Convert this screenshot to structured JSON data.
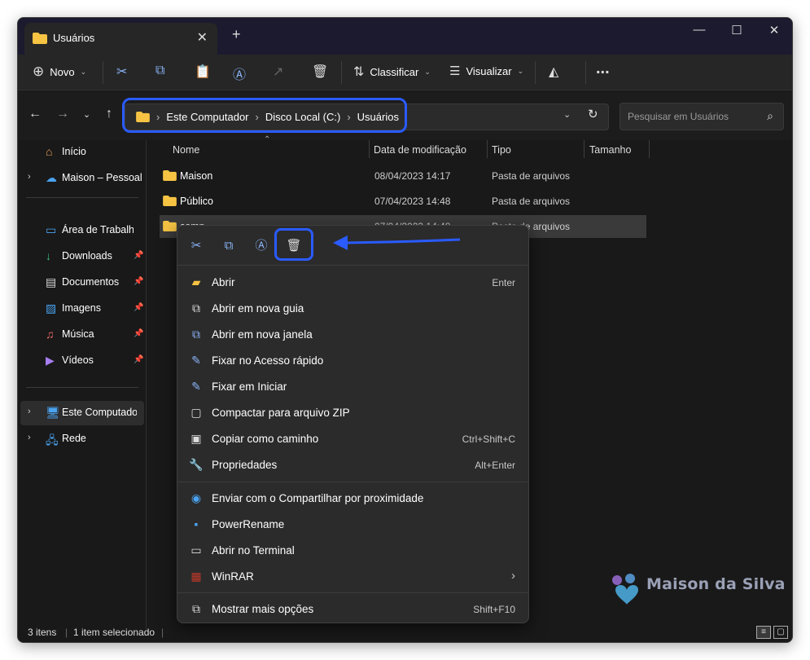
{
  "window": {
    "tab_title": "Usuários",
    "new_tab_icon": "plus-icon",
    "controls": [
      "minimize-icon",
      "maximize-icon",
      "close-icon"
    ]
  },
  "toolbar": {
    "new_label": "Novo",
    "sort_label": "Classificar",
    "view_label": "Visualizar",
    "more_label": "..."
  },
  "address": {
    "crumbs": [
      "Este Computador",
      "Disco Local (C:)",
      "Usuários"
    ],
    "search_placeholder": "Pesquisar em Usuários"
  },
  "sidebar": {
    "top_items": [
      {
        "label": "Início",
        "icon": "home-icon"
      },
      {
        "label": "Maison – Pessoal",
        "icon": "cloud-icon"
      }
    ],
    "quick_items": [
      {
        "label": "Área de Trabalho",
        "icon": "desktop-icon"
      },
      {
        "label": "Downloads",
        "icon": "download-icon"
      },
      {
        "label": "Documentos",
        "icon": "document-icon"
      },
      {
        "label": "Imagens",
        "icon": "image-icon"
      },
      {
        "label": "Música",
        "icon": "music-icon"
      },
      {
        "label": "Vídeos",
        "icon": "video-icon"
      }
    ],
    "bottom_items": [
      {
        "label": "Este Computador",
        "icon": "computer-icon"
      },
      {
        "label": "Rede",
        "icon": "network-icon"
      }
    ]
  },
  "columns": {
    "name": "Nome",
    "modified": "Data de modificação",
    "type": "Tipo",
    "size": "Tamanho"
  },
  "files": [
    {
      "name": "Maison",
      "modified": "08/04/2023 14:17",
      "type": "Pasta de arquivos"
    },
    {
      "name": "Público",
      "modified": "07/04/2023 14:48",
      "type": "Pasta de arquivos"
    },
    {
      "name": "comp",
      "modified": "07/04/2023 14:48",
      "type": "Pasta de arquivos"
    }
  ],
  "context_menu": {
    "quick_actions": [
      "cut-icon",
      "copy-icon",
      "rename-icon",
      "delete-icon"
    ],
    "group1": [
      {
        "label": "Abrir",
        "shortcut": "Enter",
        "icon": "folder-open-icon"
      },
      {
        "label": "Abrir em nova guia",
        "shortcut": "",
        "icon": "new-tab-icon"
      },
      {
        "label": "Abrir em nova janela",
        "shortcut": "",
        "icon": "new-window-icon"
      },
      {
        "label": "Fixar no Acesso rápido",
        "shortcut": "",
        "icon": "pin-icon"
      },
      {
        "label": "Fixar em Iniciar",
        "shortcut": "",
        "icon": "pin-start-icon"
      },
      {
        "label": "Compactar para arquivo ZIP",
        "shortcut": "",
        "icon": "zip-icon"
      },
      {
        "label": "Copiar como caminho",
        "shortcut": "Ctrl+Shift+C",
        "icon": "copy-path-icon"
      },
      {
        "label": "Propriedades",
        "shortcut": "Alt+Enter",
        "icon": "wrench-icon"
      }
    ],
    "group2": [
      {
        "label": "Enviar com o Compartilhar por proximidade",
        "shortcut": "",
        "icon": "nearby-share-icon"
      },
      {
        "label": "PowerRename",
        "shortcut": "",
        "icon": "powerrename-icon"
      },
      {
        "label": "Abrir no Terminal",
        "shortcut": "",
        "icon": "terminal-icon"
      },
      {
        "label": "WinRAR",
        "shortcut": "›",
        "icon": "winrar-icon"
      }
    ],
    "group3": [
      {
        "label": "Mostrar mais opções",
        "shortcut": "Shift+F10",
        "icon": "more-options-icon"
      }
    ]
  },
  "status": {
    "count": "3 itens",
    "selected": "1 item selecionado"
  },
  "watermark": "Maison da Silva",
  "colors": {
    "accent": "#2a5bff",
    "folder": "#f6c343",
    "icon_blue": "#8ab4f8"
  }
}
